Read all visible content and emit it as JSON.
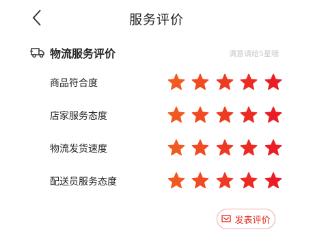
{
  "header": {
    "title": "服务评价"
  },
  "section": {
    "title": "物流服务评价",
    "hint": "满意请给5星哦"
  },
  "ratings": [
    {
      "label": "商品符合度",
      "stars": 5
    },
    {
      "label": "店家服务态度",
      "stars": 5
    },
    {
      "label": "物流发货速度",
      "stars": 5
    },
    {
      "label": "配送员服务态度",
      "stars": 5
    }
  ],
  "star_colors": [
    "#f05a21",
    "#f04b22",
    "#ee3a22",
    "#ec2b23",
    "#ea1c24"
  ],
  "submit": {
    "label": "发表评价",
    "color": "#e5271d"
  },
  "icons": {
    "back": "chevron-left-icon",
    "section": "truck-icon",
    "submit": "comment-icon"
  }
}
